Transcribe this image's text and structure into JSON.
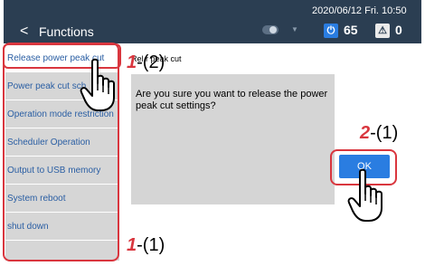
{
  "header": {
    "back_glyph": "<",
    "title": "Functions",
    "datetime": "2020/06/12 Fri. 10:50",
    "power_value": "65",
    "warning_value": "0",
    "power_icon": "power-icon",
    "warning_icon": "warning-icon"
  },
  "sidebar": {
    "items": [
      {
        "label": "Release power peak cut"
      },
      {
        "label": "Power peak cut sch"
      },
      {
        "label": "Operation mode restriction"
      },
      {
        "label": "Scheduler Operation"
      },
      {
        "label": "Output to USB memory"
      },
      {
        "label": "System reboot"
      },
      {
        "label": "shut down"
      }
    ]
  },
  "content": {
    "title": "Rel r peak cut",
    "message": "Are you sure you want to release the power peak cut settings?",
    "ok_label": "OK"
  },
  "annotations": {
    "step1_2_num": "1",
    "step1_2_sub": "-(2)",
    "step1_1_num": "1",
    "step1_1_sub": "-(1)",
    "step2_1_num": "2",
    "step2_1_sub": "-(1)"
  },
  "colors": {
    "header_bg": "#2b3e52",
    "accent_red": "#d9363e",
    "button_blue": "#2a7de1",
    "sidebar_bg": "#d6d6d6",
    "dialog_bg": "#d5d5d5"
  }
}
